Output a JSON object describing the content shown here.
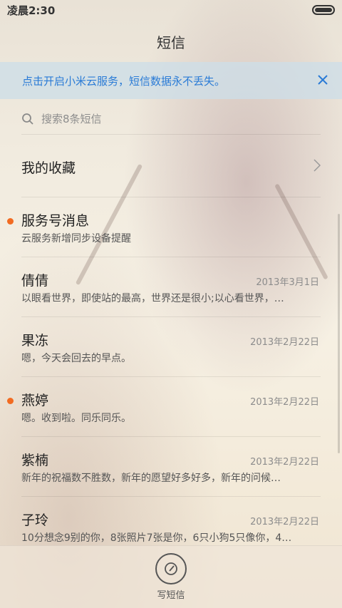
{
  "status_bar": {
    "time": "凌晨2:30",
    "battery_level": 1.0
  },
  "header": {
    "title": "短信"
  },
  "banner": {
    "text": "点击开启小米云服务，短信数据永不丢失。",
    "close_icon": "close-icon",
    "accent": "#2a7bd6"
  },
  "search": {
    "placeholder": "搜索8条短信",
    "icon": "search-icon"
  },
  "favorites": {
    "label": "我的收藏",
    "icon": "chevron-right-icon"
  },
  "conversations": [
    {
      "name": "服务号消息",
      "date": "",
      "preview": "云服务新增同步设备提醒",
      "unread": true
    },
    {
      "name": "倩倩",
      "date": "2013年3月1日",
      "preview": "以眼看世界，即使站的最高，世界还是很小;以心看世界，…",
      "unread": false
    },
    {
      "name": "果冻",
      "date": "2013年2月22日",
      "preview": "嗯，今天会回去的早点。",
      "unread": false
    },
    {
      "name": "燕婷",
      "date": "2013年2月22日",
      "preview": "嗯。收到啦。同乐同乐。",
      "unread": true
    },
    {
      "name": "紫楠",
      "date": "2013年2月22日",
      "preview": "新年的祝福数不胜数，新年的愿望好多好多，新年的问候…",
      "unread": false
    },
    {
      "name": "子玲",
      "date": "2013年2月22日",
      "preview": "10分想念9别的你，8张照片7张是你，6只小狗5只像你，4…",
      "unread": false
    }
  ],
  "compose": {
    "label": "写短信",
    "icon": "compose-icon"
  },
  "colors": {
    "unread_dot": "#f26b21",
    "accent": "#2a7bd6"
  }
}
